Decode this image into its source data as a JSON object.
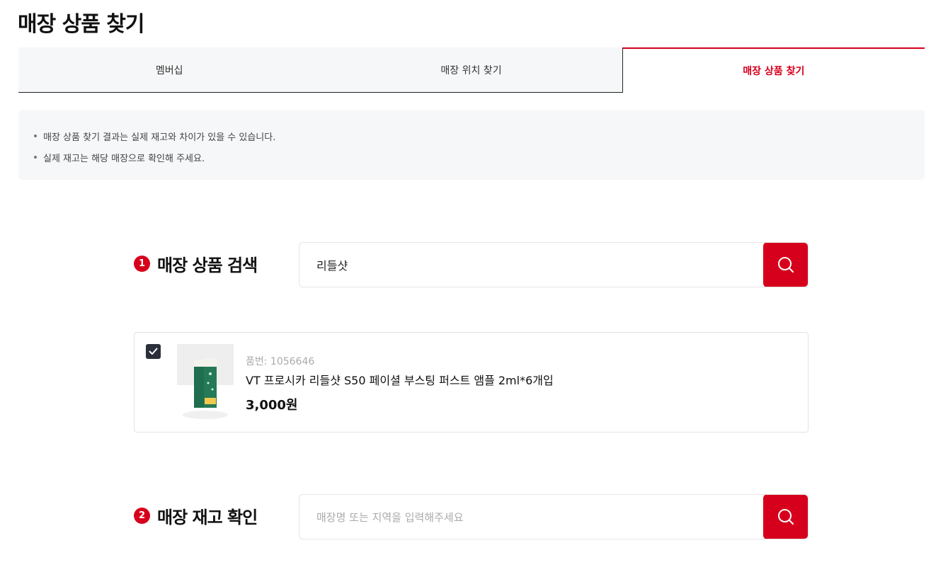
{
  "page": {
    "title": "매장 상품 찾기"
  },
  "tabs": [
    {
      "label": "멤버십",
      "active": false
    },
    {
      "label": "매장 위치 찾기",
      "active": false
    },
    {
      "label": "매장 상품 찾기",
      "active": true
    }
  ],
  "notice": {
    "items": [
      "매장 상품 찾기 결과는 실제 재고와 차이가 있을 수 있습니다.",
      "실제 재고는 해당 매장으로 확인해 주세요."
    ]
  },
  "step1": {
    "number": "1",
    "label": "매장 상품 검색",
    "value": "리들샷",
    "placeholder": ""
  },
  "product": {
    "checked": true,
    "code": "품번: 1056646",
    "name": "VT 프로시카 리들샷 S50 페이셜 부스팅 퍼스트 앰플 2ml*6개입",
    "price": "3,000원"
  },
  "step2": {
    "number": "2",
    "label": "매장 재고 확인",
    "value": "",
    "placeholder": "매장명 또는 지역을 입력해주세요"
  },
  "colors": {
    "accent": "#d6001c",
    "checkbox": "#2b2f3a",
    "notice_bg": "#f6f7f8"
  },
  "icons": {
    "search": "search-icon",
    "check": "check-icon"
  }
}
